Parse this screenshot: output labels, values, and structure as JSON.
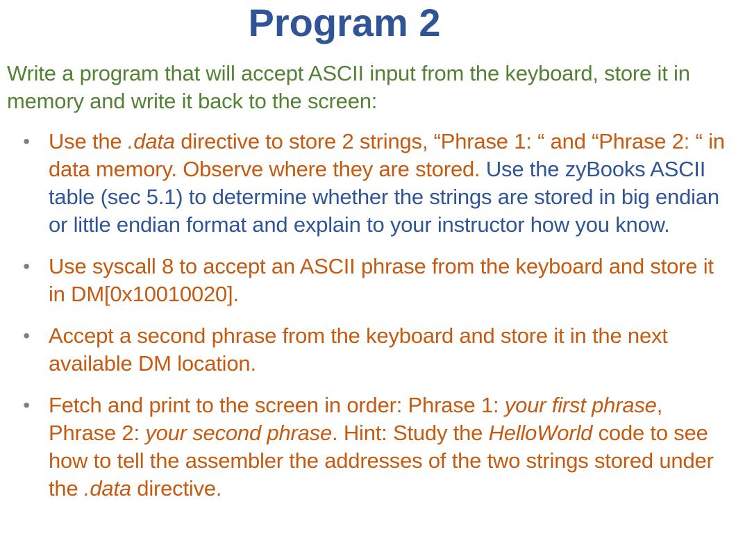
{
  "slide": {
    "title": "Program 2",
    "intro": "Write a program that will accept ASCII input from the keyboard, store it in memory and write it back to the screen:",
    "bullets": [
      {
        "part1": "Use the ",
        "italic1": ".data",
        "part2": " directive to store 2 strings, “Phrase 1: “ and “Phrase 2: “ in data memory. Observe where they are stored. ",
        "blue": "Use the zyBooks ASCII table (sec 5.1) to determine whether the strings are stored in big endian or little endian format and explain to your instructor how you know."
      },
      {
        "text": "Use syscall 8 to accept an ASCII phrase from the keyboard and store it in DM[0x10010020]."
      },
      {
        "text": "Accept a second phrase from the keyboard and store it in the next available DM location."
      },
      {
        "part1": "Fetch and print to the screen in order: Phrase 1: ",
        "italic1": "your first phrase",
        "part2": ", Phrase 2: ",
        "italic2": "your second phrase",
        "part3": ". Hint: Study the ",
        "italic3": "HelloWorld",
        "part4": " code to see how to tell the assembler the addresses of the two strings stored under the ",
        "italic4": ".data",
        "part5": " directive."
      }
    ],
    "bullet_glyph": "•"
  },
  "colors": {
    "title": "#2f5597",
    "intro": "#548235",
    "bullet_text": "#c55a11",
    "bullet_blue": "#2f5597",
    "bullet_dot": "#7f7f7f"
  }
}
